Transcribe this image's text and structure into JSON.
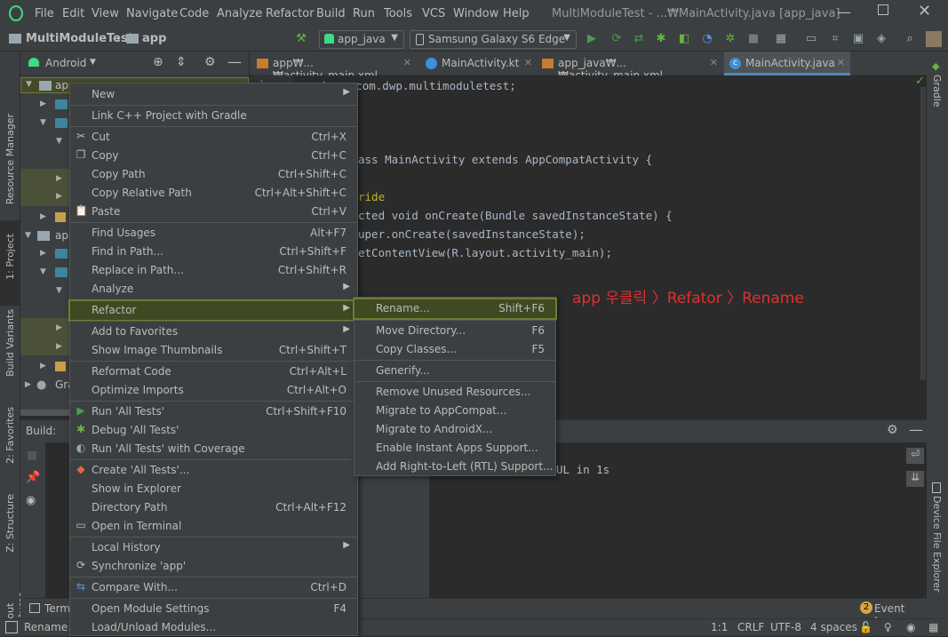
{
  "titlebar": {
    "menu": [
      "File",
      "Edit",
      "View",
      "Navigate",
      "Code",
      "Analyze",
      "Refactor",
      "Build",
      "Run",
      "Tools",
      "VCS",
      "Window",
      "Help"
    ],
    "title": "MultiModuleTest - ...₩MainActivity.java [app_java]"
  },
  "toolbar": {
    "breadcrumb_project": "MultiModuleTest",
    "breadcrumb_module": "app",
    "run_config": "app_java",
    "device": "Samsung Galaxy S6 Edge"
  },
  "project_panel": {
    "view_mode": "Android",
    "root_label": "ap",
    "root2_label": "ap",
    "gradle_label": "Gra"
  },
  "tabs": [
    {
      "label": "app₩...₩activity_main.xml",
      "active": false
    },
    {
      "label": "MainActivity.kt",
      "active": false
    },
    {
      "label": "app_java₩...₩activity_main.xml",
      "active": false
    },
    {
      "label": "MainActivity.java",
      "active": true
    }
  ],
  "editor": {
    "line_number": "1",
    "lines": [
      "package com.dwp.multimoduletest;",
      "ass MainActivity extends AppCompatActivity {",
      "ride",
      "cted void onCreate(Bundle savedInstanceState) {",
      "uper.onCreate(savedInstanceState);",
      "etContentView(R.layout.activity_main);"
    ],
    "annotation": "app 우클릭 〉Refator 〉Rename",
    "annotation_color": "#e03030"
  },
  "build": {
    "header": "Build:",
    "output": "UL in 1s"
  },
  "context_menu": {
    "items": [
      {
        "label": "New",
        "shortcut": "",
        "submenu": true
      },
      {
        "label": "Link C++ Project with Gradle",
        "shortcut": ""
      },
      {
        "label": "Cut",
        "shortcut": "Ctrl+X",
        "icon": "scissors-icon"
      },
      {
        "label": "Copy",
        "shortcut": "Ctrl+C",
        "icon": "copy-icon"
      },
      {
        "label": "Copy Path",
        "shortcut": "Ctrl+Shift+C"
      },
      {
        "label": "Copy Relative Path",
        "shortcut": "Ctrl+Alt+Shift+C"
      },
      {
        "label": "Paste",
        "shortcut": "Ctrl+V",
        "icon": "paste-icon"
      },
      {
        "label": "Find Usages",
        "shortcut": "Alt+F7"
      },
      {
        "label": "Find in Path...",
        "shortcut": "Ctrl+Shift+F"
      },
      {
        "label": "Replace in Path...",
        "shortcut": "Ctrl+Shift+R"
      },
      {
        "label": "Analyze",
        "shortcut": "",
        "submenu": true
      },
      {
        "label": "Refactor",
        "shortcut": "",
        "submenu": true,
        "highlighted": true
      },
      {
        "label": "Add to Favorites",
        "shortcut": "",
        "submenu": true
      },
      {
        "label": "Show Image Thumbnails",
        "shortcut": "Ctrl+Shift+T"
      },
      {
        "label": "Reformat Code",
        "shortcut": "Ctrl+Alt+L"
      },
      {
        "label": "Optimize Imports",
        "shortcut": "Ctrl+Alt+O"
      },
      {
        "label": "Run 'All Tests'",
        "shortcut": "Ctrl+Shift+F10",
        "icon": "run-icon"
      },
      {
        "label": "Debug 'All Tests'",
        "shortcut": "",
        "icon": "debug-icon"
      },
      {
        "label": "Run 'All Tests' with Coverage",
        "shortcut": "",
        "icon": "coverage-icon"
      },
      {
        "label": "Create 'All Tests'...",
        "shortcut": "",
        "icon": "test-icon"
      },
      {
        "label": "Show in Explorer",
        "shortcut": ""
      },
      {
        "label": "Directory Path",
        "shortcut": "Ctrl+Alt+F12"
      },
      {
        "label": "Open in Terminal",
        "shortcut": "",
        "icon": "terminal-icon"
      },
      {
        "label": "Local History",
        "shortcut": "",
        "submenu": true
      },
      {
        "label": "Synchronize 'app'",
        "shortcut": "",
        "icon": "sync-icon"
      },
      {
        "label": "Compare With...",
        "shortcut": "Ctrl+D",
        "icon": "compare-icon"
      },
      {
        "label": "Open Module Settings",
        "shortcut": "F4"
      },
      {
        "label": "Load/Unload Modules...",
        "shortcut": ""
      }
    ]
  },
  "refactor_submenu": {
    "items": [
      {
        "label": "Rename...",
        "shortcut": "Shift+F6",
        "highlighted": true
      },
      {
        "label": "Move Directory...",
        "shortcut": "F6"
      },
      {
        "label": "Copy Classes...",
        "shortcut": "F5"
      },
      {
        "label": "Generify...",
        "shortcut": ""
      },
      {
        "label": "Remove Unused Resources...",
        "shortcut": ""
      },
      {
        "label": "Migrate to AppCompat...",
        "shortcut": ""
      },
      {
        "label": "Migrate to AndroidX...",
        "shortcut": ""
      },
      {
        "label": "Enable Instant Apps Support...",
        "shortcut": ""
      },
      {
        "label": "Add Right-to-Left (RTL) Support...",
        "shortcut": ""
      }
    ]
  },
  "side_tools": {
    "left": [
      "Resource Manager",
      "1: Project",
      "Build Variants",
      "2: Favorites",
      "Z: Structure",
      "Layout Captures"
    ],
    "right": [
      "Gradle",
      "Device File Explorer"
    ]
  },
  "bottom_tools": {
    "terminal": "Termi",
    "event_log": "Event Log",
    "event_count": "2"
  },
  "status": {
    "left": "Rename t",
    "position": "1:1",
    "line_sep": "CRLF",
    "encoding": "UTF-8",
    "indent": "4 spaces"
  }
}
